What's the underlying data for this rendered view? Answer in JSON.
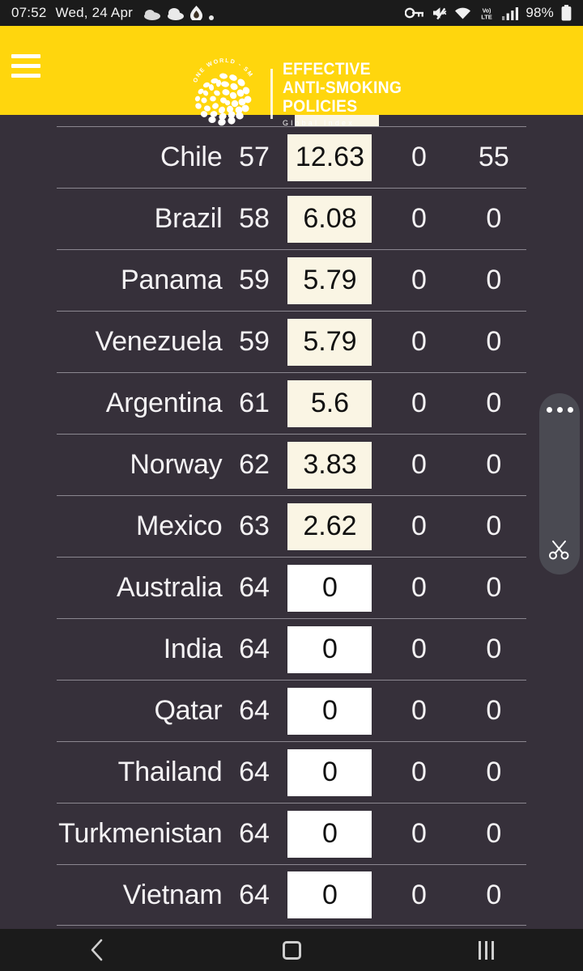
{
  "status_bar": {
    "time": "07:52",
    "date": "Wed, 24 Apr",
    "battery_percent": "98%",
    "icons": [
      "cloud-icon",
      "cloud-icon",
      "flame-icon",
      "dot-icon",
      "vpn-key-icon",
      "mute-icon",
      "wifi-icon",
      "volte-icon",
      "signal-bars-icon",
      "battery-icon"
    ]
  },
  "header": {
    "menu_label": "Menu",
    "brand": {
      "arc_text": "ONE WORLD - SMOKE FREE",
      "line1": "EFFECTIVE",
      "line2": "ANTI-SMOKING",
      "line3": "POLICIES",
      "subtitle": "Global Index"
    },
    "background_color": "#ffd60d",
    "text_color": "#ffffff"
  },
  "table": {
    "background_color": "#36303a",
    "row_divider_color": "#8b8790",
    "score_cell_color": "#faf5e4",
    "score_cell_zero_color": "#ffffff",
    "rows": [
      {
        "country": "Chile",
        "rank": "57",
        "score": "12.63",
        "col4": "0",
        "col5": "55"
      },
      {
        "country": "Brazil",
        "rank": "58",
        "score": "6.08",
        "col4": "0",
        "col5": "0"
      },
      {
        "country": "Panama",
        "rank": "59",
        "score": "5.79",
        "col4": "0",
        "col5": "0"
      },
      {
        "country": "Venezuela",
        "rank": "59",
        "score": "5.79",
        "col4": "0",
        "col5": "0"
      },
      {
        "country": "Argentina",
        "rank": "61",
        "score": "5.6",
        "col4": "0",
        "col5": "0"
      },
      {
        "country": "Norway",
        "rank": "62",
        "score": "3.83",
        "col4": "0",
        "col5": "0"
      },
      {
        "country": "Mexico",
        "rank": "63",
        "score": "2.62",
        "col4": "0",
        "col5": "0"
      },
      {
        "country": "Australia",
        "rank": "64",
        "score": "0",
        "col4": "0",
        "col5": "0"
      },
      {
        "country": "India",
        "rank": "64",
        "score": "0",
        "col4": "0",
        "col5": "0"
      },
      {
        "country": "Qatar",
        "rank": "64",
        "score": "0",
        "col4": "0",
        "col5": "0"
      },
      {
        "country": "Thailand",
        "rank": "64",
        "score": "0",
        "col4": "0",
        "col5": "0"
      },
      {
        "country": "Turkmenistan",
        "rank": "64",
        "score": "0",
        "col4": "0",
        "col5": "0"
      },
      {
        "country": "Vietnam",
        "rank": "64",
        "score": "0",
        "col4": "0",
        "col5": "0"
      }
    ]
  },
  "edge_panel": {
    "more_label": "More options",
    "snip_label": "Smart select"
  },
  "nav_bar": {
    "back_label": "Back",
    "home_label": "Home",
    "recents_label": "Recents"
  }
}
